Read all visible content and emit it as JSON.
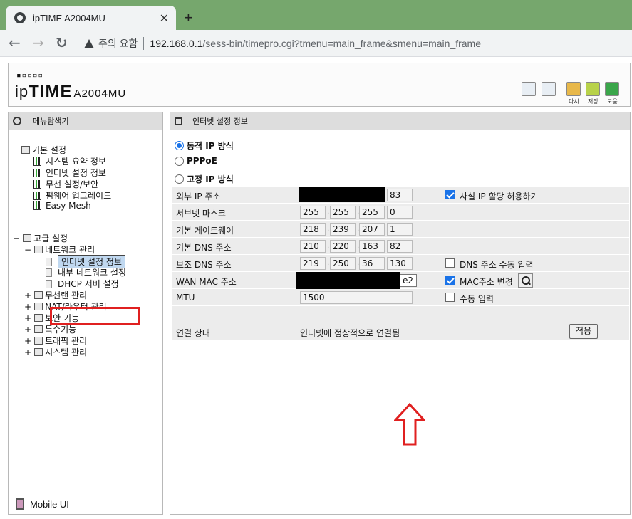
{
  "browser": {
    "tab_title": "ipTIME A2004MU",
    "close": "✕",
    "new_tab": "+",
    "back": "←",
    "forward": "→",
    "reload": "↻",
    "warning_text": "주의 요함",
    "url_host": "192.168.0.1",
    "url_path": "/sess-bin/timepro.cgi?tmenu=main_frame&smenu=main_frame"
  },
  "header": {
    "logo_dots": "▪▫▫▫▫",
    "logo_ip": "ip",
    "logo_time": "TIME",
    "model": "A2004MU",
    "icons": [
      {
        "name": "home-icon",
        "label": ""
      },
      {
        "name": "logout-icon",
        "label": ""
      },
      {
        "name": "restart-icon",
        "label": "다시"
      },
      {
        "name": "save-icon",
        "label": "저장"
      },
      {
        "name": "help-icon",
        "label": "도움"
      }
    ]
  },
  "left_panel": {
    "title": "메뉴탐색기",
    "tree": {
      "basic": "기본 설정",
      "sys_summary": "시스템 요약 정보",
      "inet_info": "인터넷 설정 정보",
      "wireless": "무선 설정/보안",
      "firmware": "펌웨어 업그레이드",
      "easymesh": "Easy Mesh",
      "advanced": "고급 설정",
      "network": "네트워크 관리",
      "inet_setting": "인터넷 설정 정보",
      "lan": "내부 네트워크 설정",
      "dhcp": "DHCP 서버 설정",
      "wlan_mgmt": "무선랜 관리",
      "nat": "NAT/라우터 관리",
      "security": "보안 기능",
      "special": "특수기능",
      "traffic": "트래픽 관리",
      "system": "시스템 관리"
    },
    "mobile_ui": "Mobile UI"
  },
  "right_panel": {
    "title": "인터넷 설정 정보",
    "mode_options": [
      "동적 IP 방식",
      "PPPoE",
      "고정 IP 방식"
    ],
    "mode_selected": "동적 IP 방식",
    "rows": {
      "external_ip_label": "외부 IP 주소",
      "external_ip_last": "83",
      "subnet_label": "서브넷 마스크",
      "subnet": [
        "255",
        "255",
        "255",
        "0"
      ],
      "gateway_label": "기본 게이트웨이",
      "gateway": [
        "218",
        "239",
        "207",
        "1"
      ],
      "dns1_label": "기본 DNS 주소",
      "dns1": [
        "210",
        "220",
        "163",
        "82"
      ],
      "dns2_label": "보조 DNS 주소",
      "dns2": [
        "219",
        "250",
        "36",
        "130"
      ],
      "mac_label": "WAN MAC 주소",
      "mac_tail": "e2",
      "mtu_label": "MTU",
      "mtu": "1500",
      "status_label": "연결 상태",
      "status_value": "인터넷에 정상적으로 연결됨"
    },
    "options": {
      "private_ip": "사설 IP 할당 허용하기",
      "dns_manual": "DNS 주소 수동 입력",
      "mac_change": "MAC주소 변경",
      "mtu_manual": "수동 입력"
    },
    "apply_label": "적용",
    "dot": "."
  }
}
